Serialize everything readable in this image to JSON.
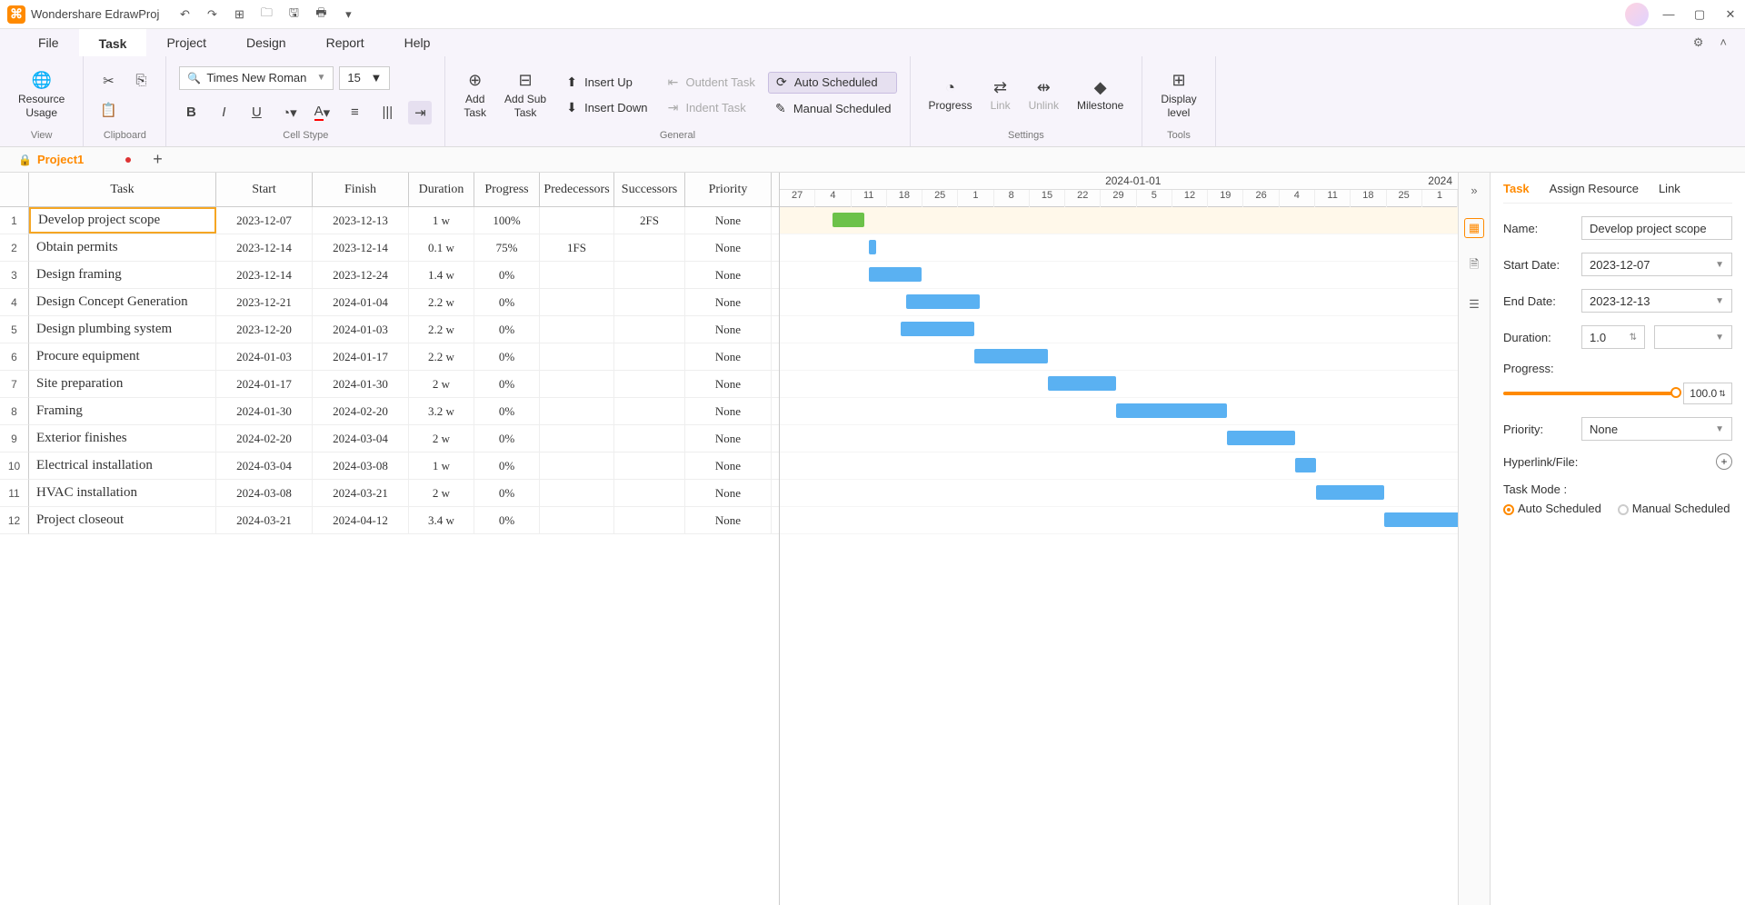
{
  "app": {
    "title": "Wondershare EdrawProj"
  },
  "menus": {
    "file": "File",
    "task": "Task",
    "project": "Project",
    "design": "Design",
    "report": "Report",
    "help": "Help"
  },
  "ribbon": {
    "resource_usage": "Resource\nUsage",
    "view": "View",
    "clipboard": "Clipboard",
    "font_name": "Times New Roman",
    "font_size": "15",
    "cell_type": "Cell Stype",
    "add_task": "Add\nTask",
    "add_sub": "Add Sub\nTask",
    "insert_up": "Insert Up",
    "insert_down": "Insert Down",
    "outdent": "Outdent Task",
    "indent": "Indent Task",
    "auto_sched": "Auto Scheduled",
    "manual_sched": "Manual Scheduled",
    "general": "General",
    "progress": "Progress",
    "link": "Link",
    "unlink": "Unlink",
    "milestone": "Milestone",
    "settings": "Settings",
    "display_level": "Display\nlevel",
    "tools": "Tools"
  },
  "doc_tab": "Project1",
  "columns": {
    "task": "Task",
    "start": "Start",
    "finish": "Finish",
    "duration": "Duration",
    "progress": "Progress",
    "pred": "Predecessors",
    "succ": "Successors",
    "priority": "Priority"
  },
  "rows": [
    {
      "n": "1",
      "task": "Develop project scope",
      "start": "2023-12-07",
      "finish": "2023-12-13",
      "dur": "1 w",
      "prog": "100%",
      "pred": "",
      "succ": "2FS",
      "prio": "None"
    },
    {
      "n": "2",
      "task": "Obtain permits",
      "start": "2023-12-14",
      "finish": "2023-12-14",
      "dur": "0.1 w",
      "prog": "75%",
      "pred": "1FS",
      "succ": "",
      "prio": "None"
    },
    {
      "n": "3",
      "task": "Design framing",
      "start": "2023-12-14",
      "finish": "2023-12-24",
      "dur": "1.4 w",
      "prog": "0%",
      "pred": "",
      "succ": "",
      "prio": "None"
    },
    {
      "n": "4",
      "task": "Design Concept Generation",
      "start": "2023-12-21",
      "finish": "2024-01-04",
      "dur": "2.2 w",
      "prog": "0%",
      "pred": "",
      "succ": "",
      "prio": "None"
    },
    {
      "n": "5",
      "task": "Design plumbing system",
      "start": "2023-12-20",
      "finish": "2024-01-03",
      "dur": "2.2 w",
      "prog": "0%",
      "pred": "",
      "succ": "",
      "prio": "None"
    },
    {
      "n": "6",
      "task": "Procure equipment",
      "start": "2024-01-03",
      "finish": "2024-01-17",
      "dur": "2.2 w",
      "prog": "0%",
      "pred": "",
      "succ": "",
      "prio": "None"
    },
    {
      "n": "7",
      "task": "Site preparation",
      "start": "2024-01-17",
      "finish": "2024-01-30",
      "dur": "2 w",
      "prog": "0%",
      "pred": "",
      "succ": "",
      "prio": "None"
    },
    {
      "n": "8",
      "task": "Framing",
      "start": "2024-01-30",
      "finish": "2024-02-20",
      "dur": "3.2 w",
      "prog": "0%",
      "pred": "",
      "succ": "",
      "prio": "None"
    },
    {
      "n": "9",
      "task": "Exterior finishes",
      "start": "2024-02-20",
      "finish": "2024-03-04",
      "dur": "2 w",
      "prog": "0%",
      "pred": "",
      "succ": "",
      "prio": "None"
    },
    {
      "n": "10",
      "task": "Electrical installation",
      "start": "2024-03-04",
      "finish": "2024-03-08",
      "dur": "1 w",
      "prog": "0%",
      "pred": "",
      "succ": "",
      "prio": "None"
    },
    {
      "n": "11",
      "task": "HVAC installation",
      "start": "2024-03-08",
      "finish": "2024-03-21",
      "dur": "2 w",
      "prog": "0%",
      "pred": "",
      "succ": "",
      "prio": "None"
    },
    {
      "n": "12",
      "task": "Project closeout",
      "start": "2024-03-21",
      "finish": "2024-04-12",
      "dur": "3.4 w",
      "prog": "0%",
      "pred": "",
      "succ": "",
      "prio": "None"
    }
  ],
  "gantt": {
    "month1": "2024-01-01",
    "month2": "2024",
    "days": [
      "27",
      "4",
      "11",
      "18",
      "25",
      "1",
      "8",
      "15",
      "22",
      "29",
      "5",
      "12",
      "19",
      "26",
      "4",
      "11",
      "18",
      "25",
      "1"
    ]
  },
  "props_tabs": {
    "task": "Task",
    "resource": "Assign Resource",
    "link": "Link"
  },
  "props": {
    "name_label": "Name:",
    "name_value": "Develop project scope",
    "start_label": "Start Date:",
    "start_value": "2023-12-07",
    "end_label": "End Date:",
    "end_value": "2023-12-13",
    "dur_label": "Duration:",
    "dur_value": "1.0",
    "prog_label": "Progress:",
    "prog_value": "100.0",
    "prio_label": "Priority:",
    "prio_value": "None",
    "hyperlink_label": "Hyperlink/File:",
    "mode_label": "Task Mode :",
    "auto": "Auto Scheduled",
    "manual": "Manual Scheduled"
  },
  "chart_data": {
    "type": "gantt",
    "x_axis_ticks": [
      "2023-11-27",
      "2023-12-04",
      "2023-12-11",
      "2023-12-18",
      "2023-12-25",
      "2024-01-01",
      "2024-01-08",
      "2024-01-15",
      "2024-01-22",
      "2024-01-29",
      "2024-02-05",
      "2024-02-12",
      "2024-02-19",
      "2024-02-26",
      "2024-03-04",
      "2024-03-11",
      "2024-03-18",
      "2024-03-25",
      "2024-04-01"
    ],
    "tasks": [
      {
        "name": "Develop project scope",
        "start": "2023-12-07",
        "end": "2023-12-13",
        "progress": 100
      },
      {
        "name": "Obtain permits",
        "start": "2023-12-14",
        "end": "2023-12-14",
        "progress": 75
      },
      {
        "name": "Design framing",
        "start": "2023-12-14",
        "end": "2023-12-24",
        "progress": 0
      },
      {
        "name": "Design Concept Generation",
        "start": "2023-12-21",
        "end": "2024-01-04",
        "progress": 0
      },
      {
        "name": "Design plumbing system",
        "start": "2023-12-20",
        "end": "2024-01-03",
        "progress": 0
      },
      {
        "name": "Procure equipment",
        "start": "2024-01-03",
        "end": "2024-01-17",
        "progress": 0
      },
      {
        "name": "Site preparation",
        "start": "2024-01-17",
        "end": "2024-01-30",
        "progress": 0
      },
      {
        "name": "Framing",
        "start": "2024-01-30",
        "end": "2024-02-20",
        "progress": 0
      },
      {
        "name": "Exterior finishes",
        "start": "2024-02-20",
        "end": "2024-03-04",
        "progress": 0
      },
      {
        "name": "Electrical installation",
        "start": "2024-03-04",
        "end": "2024-03-08",
        "progress": 0
      },
      {
        "name": "HVAC installation",
        "start": "2024-03-08",
        "end": "2024-03-21",
        "progress": 0
      },
      {
        "name": "Project closeout",
        "start": "2024-03-21",
        "end": "2024-04-12",
        "progress": 0
      }
    ]
  }
}
